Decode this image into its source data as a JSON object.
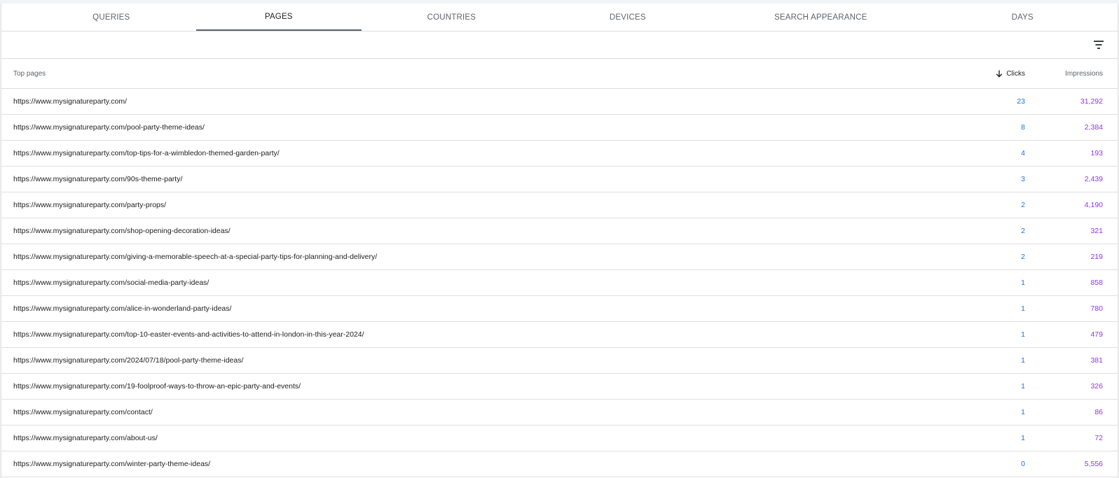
{
  "tabs": [
    {
      "label": "QUERIES",
      "active": false
    },
    {
      "label": "PAGES",
      "active": true
    },
    {
      "label": "COUNTRIES",
      "active": false
    },
    {
      "label": "DEVICES",
      "active": false
    },
    {
      "label": "SEARCH APPEARANCE",
      "active": false
    },
    {
      "label": "DAYS",
      "active": false
    }
  ],
  "filter_icon": "filter-list-icon",
  "table": {
    "columns": {
      "pages": "Top pages",
      "clicks": "Clicks",
      "impressions": "Impressions"
    },
    "sort_icon": "arrow-down-icon",
    "rows": [
      {
        "url": "https://www.mysignatureparty.com/",
        "clicks": "23",
        "impressions": "31,292"
      },
      {
        "url": "https://www.mysignatureparty.com/pool-party-theme-ideas/",
        "clicks": "8",
        "impressions": "2,384"
      },
      {
        "url": "https://www.mysignatureparty.com/top-tips-for-a-wimbledon-themed-garden-party/",
        "clicks": "4",
        "impressions": "193"
      },
      {
        "url": "https://www.mysignatureparty.com/90s-theme-party/",
        "clicks": "3",
        "impressions": "2,439"
      },
      {
        "url": "https://www.mysignatureparty.com/party-props/",
        "clicks": "2",
        "impressions": "4,190"
      },
      {
        "url": "https://www.mysignatureparty.com/shop-opening-decoration-ideas/",
        "clicks": "2",
        "impressions": "321"
      },
      {
        "url": "https://www.mysignatureparty.com/giving-a-memorable-speech-at-a-special-party-tips-for-planning-and-delivery/",
        "clicks": "2",
        "impressions": "219"
      },
      {
        "url": "https://www.mysignatureparty.com/social-media-party-ideas/",
        "clicks": "1",
        "impressions": "858"
      },
      {
        "url": "https://www.mysignatureparty.com/alice-in-wonderland-party-ideas/",
        "clicks": "1",
        "impressions": "780"
      },
      {
        "url": "https://www.mysignatureparty.com/top-10-easter-events-and-activities-to-attend-in-london-in-this-year-2024/",
        "clicks": "1",
        "impressions": "479"
      },
      {
        "url": "https://www.mysignatureparty.com/2024/07/18/pool-party-theme-ideas/",
        "clicks": "1",
        "impressions": "381"
      },
      {
        "url": "https://www.mysignatureparty.com/19-foolproof-ways-to-throw-an-epic-party-and-events/",
        "clicks": "1",
        "impressions": "326"
      },
      {
        "url": "https://www.mysignatureparty.com/contact/",
        "clicks": "1",
        "impressions": "86"
      },
      {
        "url": "https://www.mysignatureparty.com/about-us/",
        "clicks": "1",
        "impressions": "72"
      },
      {
        "url": "https://www.mysignatureparty.com/winter-party-theme-ideas/",
        "clicks": "0",
        "impressions": "5,556"
      }
    ]
  },
  "colors": {
    "clicks": "#1a73e8",
    "impressions": "#9334e6",
    "active_tab_indicator": "#5f6368"
  }
}
